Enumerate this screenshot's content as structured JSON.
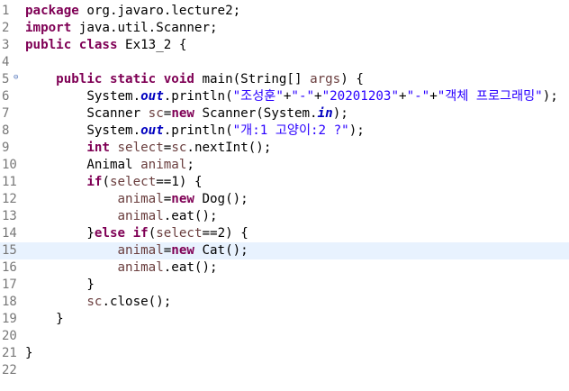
{
  "editor": {
    "lines": [
      {
        "num": "1",
        "seg": [
          {
            "k": "kw",
            "t": "package"
          },
          {
            "k": "",
            "t": " org.javaro.lecture2;"
          }
        ]
      },
      {
        "num": "2",
        "seg": [
          {
            "k": "kw",
            "t": "import"
          },
          {
            "k": "",
            "t": " java.util.Scanner;"
          }
        ]
      },
      {
        "num": "3",
        "seg": [
          {
            "k": "kw",
            "t": "public"
          },
          {
            "k": "",
            "t": " "
          },
          {
            "k": "kw",
            "t": "class"
          },
          {
            "k": "",
            "t": " Ex13_2 {"
          }
        ]
      },
      {
        "num": "4",
        "seg": []
      },
      {
        "num": "5",
        "fold": "⊖",
        "seg": [
          {
            "k": "",
            "t": "    "
          },
          {
            "k": "kw",
            "t": "public"
          },
          {
            "k": "",
            "t": " "
          },
          {
            "k": "kw",
            "t": "static"
          },
          {
            "k": "",
            "t": " "
          },
          {
            "k": "kw",
            "t": "void"
          },
          {
            "k": "",
            "t": " main(String[] "
          },
          {
            "k": "loc",
            "t": "args"
          },
          {
            "k": "",
            "t": ") {"
          }
        ]
      },
      {
        "num": "6",
        "seg": [
          {
            "k": "",
            "t": "        System."
          },
          {
            "k": "fld",
            "t": "out"
          },
          {
            "k": "",
            "t": ".println("
          },
          {
            "k": "str",
            "t": "\"조성훈\""
          },
          {
            "k": "",
            "t": "+"
          },
          {
            "k": "str",
            "t": "\"-\""
          },
          {
            "k": "",
            "t": "+"
          },
          {
            "k": "str",
            "t": "\"20201203\""
          },
          {
            "k": "",
            "t": "+"
          },
          {
            "k": "str",
            "t": "\"-\""
          },
          {
            "k": "",
            "t": "+"
          },
          {
            "k": "str",
            "t": "\"객체 프로그래밍\""
          },
          {
            "k": "",
            "t": ");"
          }
        ]
      },
      {
        "num": "7",
        "seg": [
          {
            "k": "",
            "t": "        Scanner "
          },
          {
            "k": "loc",
            "t": "sc"
          },
          {
            "k": "",
            "t": "="
          },
          {
            "k": "kw",
            "t": "new"
          },
          {
            "k": "",
            "t": " Scanner(System."
          },
          {
            "k": "fld",
            "t": "in"
          },
          {
            "k": "",
            "t": ");"
          }
        ]
      },
      {
        "num": "8",
        "seg": [
          {
            "k": "",
            "t": "        System."
          },
          {
            "k": "fld",
            "t": "out"
          },
          {
            "k": "",
            "t": ".println("
          },
          {
            "k": "str",
            "t": "\"개:1 고양이:2 ?\""
          },
          {
            "k": "",
            "t": ");"
          }
        ]
      },
      {
        "num": "9",
        "seg": [
          {
            "k": "",
            "t": "        "
          },
          {
            "k": "kw",
            "t": "int"
          },
          {
            "k": "",
            "t": " "
          },
          {
            "k": "loc",
            "t": "select"
          },
          {
            "k": "",
            "t": "="
          },
          {
            "k": "loc",
            "t": "sc"
          },
          {
            "k": "",
            "t": ".nextInt();"
          }
        ]
      },
      {
        "num": "10",
        "seg": [
          {
            "k": "",
            "t": "        Animal "
          },
          {
            "k": "loc",
            "t": "animal"
          },
          {
            "k": "",
            "t": ";"
          }
        ]
      },
      {
        "num": "11",
        "seg": [
          {
            "k": "",
            "t": "        "
          },
          {
            "k": "kw",
            "t": "if"
          },
          {
            "k": "",
            "t": "("
          },
          {
            "k": "loc",
            "t": "select"
          },
          {
            "k": "",
            "t": "==1) {"
          }
        ]
      },
      {
        "num": "12",
        "seg": [
          {
            "k": "",
            "t": "            "
          },
          {
            "k": "loc",
            "t": "animal"
          },
          {
            "k": "",
            "t": "="
          },
          {
            "k": "kw",
            "t": "new"
          },
          {
            "k": "",
            "t": " Dog();"
          }
        ]
      },
      {
        "num": "13",
        "seg": [
          {
            "k": "",
            "t": "            "
          },
          {
            "k": "loc",
            "t": "animal"
          },
          {
            "k": "",
            "t": ".eat();"
          }
        ]
      },
      {
        "num": "14",
        "seg": [
          {
            "k": "",
            "t": "        }"
          },
          {
            "k": "kw",
            "t": "else"
          },
          {
            "k": "",
            "t": " "
          },
          {
            "k": "kw",
            "t": "if"
          },
          {
            "k": "",
            "t": "("
          },
          {
            "k": "loc",
            "t": "select"
          },
          {
            "k": "",
            "t": "==2) {"
          }
        ]
      },
      {
        "num": "15",
        "current": true,
        "seg": [
          {
            "k": "",
            "t": "            "
          },
          {
            "k": "loc",
            "t": "animal"
          },
          {
            "k": "",
            "t": "="
          },
          {
            "k": "kw",
            "t": "new"
          },
          {
            "k": "",
            "t": " Cat();"
          }
        ]
      },
      {
        "num": "16",
        "seg": [
          {
            "k": "",
            "t": "            "
          },
          {
            "k": "loc",
            "t": "animal"
          },
          {
            "k": "",
            "t": ".eat();"
          }
        ]
      },
      {
        "num": "17",
        "seg": [
          {
            "k": "",
            "t": "        }"
          }
        ]
      },
      {
        "num": "18",
        "seg": [
          {
            "k": "",
            "t": "        "
          },
          {
            "k": "loc",
            "t": "sc"
          },
          {
            "k": "",
            "t": ".close();"
          }
        ]
      },
      {
        "num": "19",
        "seg": [
          {
            "k": "",
            "t": "    }"
          }
        ]
      },
      {
        "num": "20",
        "seg": []
      },
      {
        "num": "21",
        "seg": [
          {
            "k": "",
            "t": "}"
          }
        ]
      },
      {
        "num": "22",
        "seg": []
      }
    ]
  },
  "colors": {
    "keyword": "#7f0055",
    "string": "#2a00ff",
    "static_field": "#0000c0",
    "local_variable": "#6a3e3e",
    "current_line": "#e8f2fe",
    "line_number": "#787878"
  },
  "icons": {
    "fold": "collapse-fold-icon"
  }
}
